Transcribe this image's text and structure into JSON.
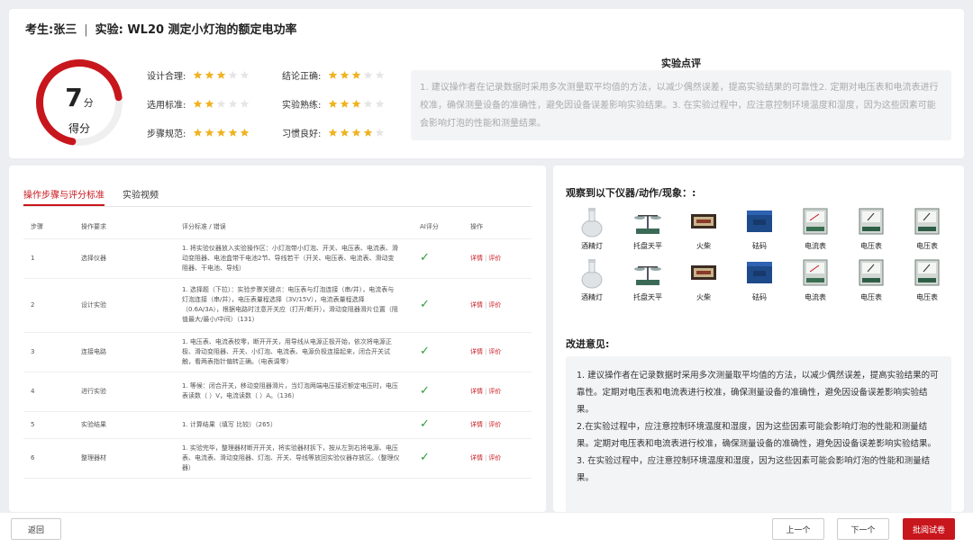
{
  "header": {
    "candidate": "考生:张三",
    "separator": "|",
    "experiment": "实验: WL20 测定小灯泡的额定电功率"
  },
  "score": {
    "value": "7",
    "unit": "分",
    "label": "得分",
    "max": 10,
    "accent": "#c8161d"
  },
  "criteria": [
    {
      "label": "设计合理:",
      "stars": 3,
      "max": 5
    },
    {
      "label": "选用标准:",
      "stars": 2,
      "max": 5
    },
    {
      "label": "步骤规范:",
      "stars": 5,
      "max": 5
    },
    {
      "label": "结论正确:",
      "stars": 3,
      "max": 5
    },
    {
      "label": "实验熟练:",
      "stars": 3,
      "max": 5
    },
    {
      "label": "习惯良好:",
      "stars": 4,
      "max": 5
    }
  ],
  "review": {
    "title": "实验点评",
    "text": "1. 建议操作者在记录数据时采用多次测量取平均值的方法，以减少偶然误差，提高实验结果的可靠性2. 定期对电压表和电流表进行校准，确保测量设备的准确性，避免因设备误差影响实验结果。3. 在实验过程中，应注意控制环境温度和湿度，因为这些因素可能会影响灯泡的性能和测量结果。"
  },
  "tabs": [
    {
      "label": "操作步骤与评分标准",
      "active": true
    },
    {
      "label": "实验视频",
      "active": false
    }
  ],
  "table": {
    "headers": [
      "步骤",
      "操作要求",
      "评分标准 / 错误",
      "AI评分",
      "操作"
    ],
    "rows": [
      {
        "step": "1",
        "req": "选择仪器",
        "crit": "1. 将实验仪器放入实验操作区：小灯泡带小灯泡、开关、电压表、电流表、滑动变阻器、电池盒带干电池2节、导线若干（开关、电压表、电流表、滑动变阻器、干电池、导线）",
        "op_a": "详情",
        "op_b": "评价"
      },
      {
        "step": "2",
        "req": "设计实验",
        "crit": "1. 选择题（下拉）：实验步骤关键点：电压表与灯泡连接（串/并），电流表与灯泡连接（串/并），电压表量程选择（3V/15V），电流表量程选择（0.6A/3A），根据电路时注意开关应（打开/断开），滑动变阻器滑片位置（阻值最大/最小/中间）（131）",
        "op_a": "详情",
        "op_b": "评价"
      },
      {
        "step": "3",
        "req": "连接电路",
        "crit": "1. 电压表、电流表校零，断开开关，用导线从电源正极开始，依次将电源正极、滑动变阻器、开关、小灯泡、电流表、电源负极连接起来，闭合开关试触，看两表指针偏转正确。（电表调零）",
        "op_a": "详情",
        "op_b": "评价"
      },
      {
        "step": "4",
        "req": "进行实验",
        "crit": "1. 等候：闭合开关，移动变阻器滑片，当灯泡两端电压接近额定电压时，电压表读数（ ）V，电流读数（ ）A。（136）",
        "op_a": "详情",
        "op_b": "评价"
      },
      {
        "step": "5",
        "req": "实验结果",
        "crit": "1. 计算结果（填写 比较）（265）",
        "op_a": "详情",
        "op_b": "评价"
      },
      {
        "step": "6",
        "req": "整理器材",
        "crit": "1. 实验完毕，整理器材断开开关，将实验器材拆下，按从左到右将电源、电压表、电流表、滑动变阻器、灯泡、开关、导线等放回实验仪器存放区。（整理仪器）",
        "op_a": "详情",
        "op_b": "评价"
      }
    ]
  },
  "observations": {
    "title": "观察到以下仪器/动作/现象：:",
    "items": [
      {
        "name": "酒精灯",
        "kind": "lamp"
      },
      {
        "name": "托盘天平",
        "kind": "balance"
      },
      {
        "name": "火柴",
        "kind": "matches"
      },
      {
        "name": "砝码",
        "kind": "weights"
      },
      {
        "name": "电流表",
        "kind": "ammeter"
      },
      {
        "name": "电压表",
        "kind": "voltmeter"
      },
      {
        "name": "电压表",
        "kind": "voltmeter"
      },
      {
        "name": "酒精灯",
        "kind": "lamp"
      },
      {
        "name": "托盘天平",
        "kind": "balance"
      },
      {
        "name": "火柴",
        "kind": "matches"
      },
      {
        "name": "砝码",
        "kind": "weights"
      },
      {
        "name": "电流表",
        "kind": "ammeter"
      },
      {
        "name": "电压表",
        "kind": "voltmeter"
      },
      {
        "name": "电压表",
        "kind": "voltmeter"
      }
    ]
  },
  "suggestions": {
    "title": "改进意见:",
    "lines": [
      "1. 建议操作者在记录数据时采用多次测量取平均值的方法，以减少偶然误差，提高实验结果的可靠性。定期对电压表和电流表进行校准，确保测量设备的准确性，避免因设备误差影响实验结果。",
      "2.在实验过程中，应注意控制环境温度和湿度，因为这些因素可能会影响灯泡的性能和测量结果。定期对电压表和电流表进行校准，确保测量设备的准确性，避免因设备误差影响实验结果。",
      "3. 在实验过程中，应注意控制环境温度和湿度，因为这些因素可能会影响灯泡的性能和测量结果。"
    ]
  },
  "footer": {
    "back": "返回",
    "prev": "上一个",
    "next": "下一个",
    "grade": "批阅试卷"
  },
  "colors": {
    "accent": "#c8161d",
    "star_on": "#f0b320",
    "star_off": "#e6e6e6",
    "check": "#2e9b3a"
  }
}
